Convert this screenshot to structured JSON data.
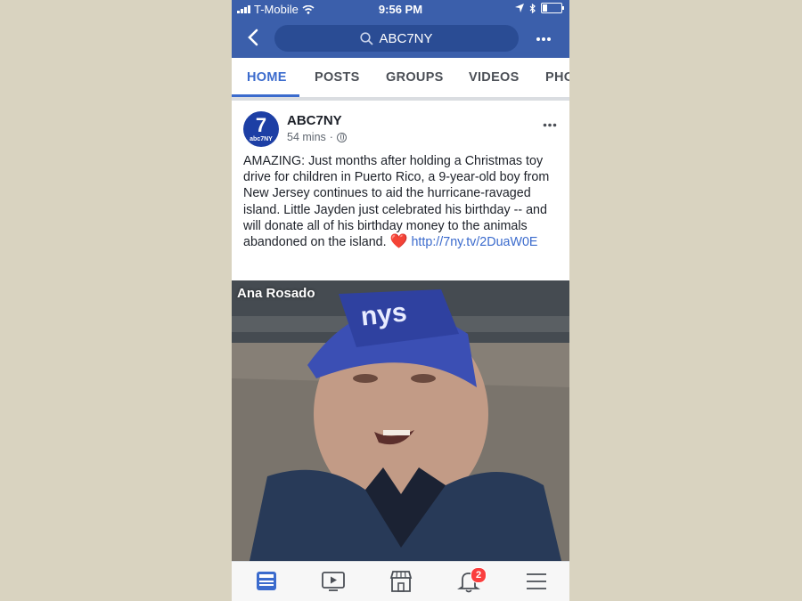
{
  "status_bar": {
    "carrier": "T-Mobile",
    "time": "9:56 PM"
  },
  "header": {
    "search_text": "ABC7NY"
  },
  "tabs": [
    {
      "label": "HOME",
      "active": true
    },
    {
      "label": "POSTS",
      "active": false
    },
    {
      "label": "GROUPS",
      "active": false
    },
    {
      "label": "VIDEOS",
      "active": false
    },
    {
      "label": "PHO",
      "active": false
    }
  ],
  "post": {
    "page_name": "ABC7NY",
    "avatar_big": "7",
    "avatar_small": "abc7NY",
    "time_ago": "54 mins",
    "separator": "·",
    "body": "AMAZING: Just months after holding a Christmas toy drive for children in Puerto Rico, a 9-year-old boy from New Jersey continues to aid the hurricane-ravaged island. Little Jayden just celebrated his birthday -- and will donate all of his birthday money to the animals abandoned on the island.",
    "heart": "❤️",
    "link": "http://7ny.tv/2DuaW0E",
    "video_label": "Ana Rosado"
  },
  "bottom_nav": {
    "notifications_badge": "2"
  },
  "colors": {
    "brand": "#3b5fab",
    "active_tab": "#3b6bcd",
    "badge": "#fa3e3e"
  }
}
